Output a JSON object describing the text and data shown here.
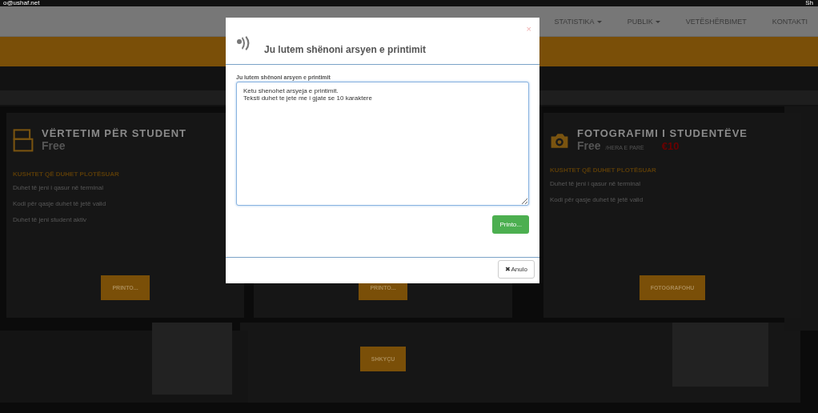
{
  "top_bar": {
    "email": "o@ushaf.net",
    "right_text": "Sh"
  },
  "nav": [
    {
      "label": "STATISTIKA",
      "dropdown": true
    },
    {
      "label": "PUBLIK",
      "dropdown": true
    },
    {
      "label": "VETËSHËRBIMET",
      "dropdown": false
    },
    {
      "label": "KONTAKTI",
      "dropdown": false
    }
  ],
  "cards": [
    {
      "kind": "printer",
      "title": "VËRTETIM PËR STUDENT",
      "price": "Free",
      "conditions_title": "KUSHTET QË DUHET PLOTËSUAR",
      "conditions": [
        "Duhet të jeni i qasur në terminal",
        "Kodi për qasje duhet të jetë valid",
        "Duhet të jeni student aktiv"
      ],
      "button": "PRINTO..."
    },
    {
      "kind": "hidden",
      "button": "PRINTO..."
    },
    {
      "kind": "camera",
      "title": "FOTOGRAFIMI I STUDENTËVE",
      "price": "Free",
      "price_note": "/HERA E PARË",
      "extra_price": "€10",
      "conditions_title": "KUSHTET QË DUHET PLOTËSUAR",
      "conditions": [
        "Duhet të jeni i qasur në terminal",
        "Kodi për qasje duhet të jetë valid"
      ],
      "button": "FOTOGRAFOHU"
    }
  ],
  "logout_button": "SHKYÇU",
  "modal": {
    "title": "Ju lutem shënoni arsyen e printimit",
    "close": "×",
    "field_label": "Ju lutem shënoni arsyen e printimit",
    "field_value": "Ketu shenohet arsyeja e printimit.\nTeksti duhet te jete me i gjate se 10 karaktere",
    "print_button": "Printo...",
    "cancel_icon": "✖",
    "cancel_button": "Anulo"
  }
}
